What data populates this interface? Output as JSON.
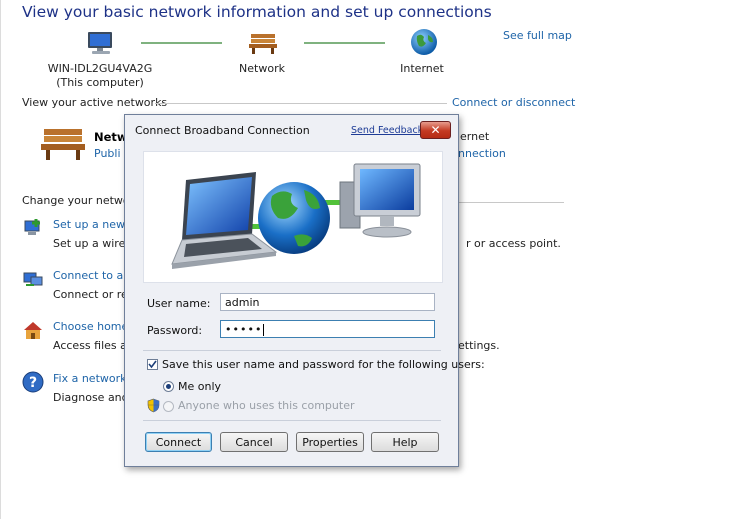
{
  "header": {
    "title": "View your basic network information and set up connections"
  },
  "map": {
    "see_full_map": "See full map",
    "computer_name": "WIN-IDL2GU4VA2G",
    "computer_sub": "(This computer)",
    "network_label": "Network",
    "internet_label": "Internet"
  },
  "active": {
    "section_label": "View your active networks",
    "connect_disconnect": "Connect or disconnect",
    "network_name": "Netwo",
    "network_type": "Publi",
    "access_label": "ernet",
    "access_value": "nnection"
  },
  "change": {
    "section_label": "Change your networ",
    "tasks": [
      {
        "title": "Set up a new c",
        "desc": "Set up a wirele",
        "desc_tail": "r or access point."
      },
      {
        "title": "Connect to a n",
        "desc": "Connect or rec",
        "desc_tail": ""
      },
      {
        "title": "Choose home",
        "desc": "Access files an",
        "desc_tail": "ettings."
      },
      {
        "title": "Fix a network p",
        "desc": "Diagnose and",
        "desc_tail": ""
      }
    ]
  },
  "dialog": {
    "title": "Connect Broadband Connection",
    "feedback": "Send Feedback",
    "close": "✕",
    "username_label": "User name:",
    "username_value": "admin",
    "password_label": "Password:",
    "password_value": "•••••",
    "save_label": "Save this user name and password for the following users:",
    "save_checked": true,
    "me_only_label": "Me only",
    "anyone_label": "Anyone who uses this computer",
    "buttons": {
      "connect": "Connect",
      "cancel": "Cancel",
      "properties": "Properties",
      "help": "Help"
    }
  },
  "colors": {
    "title": "#1e3287",
    "link": "#1e64a8",
    "dialog_bg": "#eef0f5",
    "close_red": "#c43a22"
  }
}
